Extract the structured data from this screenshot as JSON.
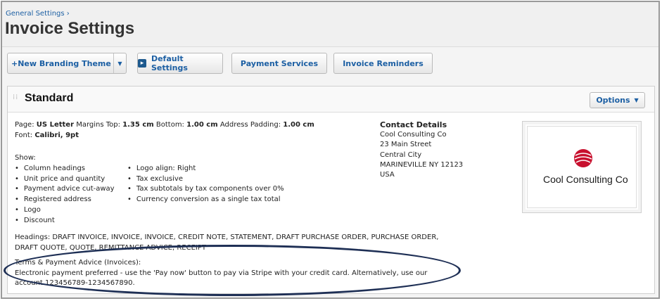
{
  "header": {
    "breadcrumb": "General Settings ›",
    "title": "Invoice Settings"
  },
  "toolbar": {
    "new_branding_theme": "New Branding Theme",
    "default_settings": "Default Settings",
    "payment_services": "Payment Services",
    "invoice_reminders": "Invoice Reminders"
  },
  "panel": {
    "title": "Standard",
    "options_label": "Options",
    "page_line": {
      "page_label": "Page:",
      "page_value": "US Letter",
      "margins_top_label": "Margins Top:",
      "margins_top_value": "1.35 cm",
      "bottom_label": "Bottom:",
      "bottom_value": "1.00 cm",
      "padding_label": "Address Padding:",
      "padding_value": "1.00 cm"
    },
    "font_line": {
      "font_label": "Font:",
      "font_value": "Calibri, 9pt"
    },
    "show_label": "Show:",
    "show_items_col1": [
      "Column headings",
      "Unit price and quantity",
      "Payment advice cut-away",
      "Registered address",
      "Logo",
      "Discount"
    ],
    "show_items_col2": [
      "Logo align: Right",
      "Tax exclusive",
      "Tax subtotals by tax components over 0%",
      "Currency conversion as a single tax total"
    ],
    "headings_text": "Headings: DRAFT INVOICE, INVOICE, INVOICE, CREDIT NOTE, STATEMENT, DRAFT PURCHASE ORDER, PURCHASE ORDER, DRAFT QUOTE, QUOTE, REMITTANCE ADVICE, RECEIPT",
    "terms_label": "Terms & Payment Advice (Invoices):",
    "terms_text": "Electronic payment preferred - use the 'Pay now' button to pay via Stripe with your credit card. Alternatively, use our account 123456789-1234567890.",
    "contact": {
      "heading": "Contact Details",
      "lines": [
        "Cool Consulting Co",
        "23 Main Street",
        "Central City",
        "MARINEVILLE NY 12123",
        "USA"
      ]
    },
    "logo_text": "Cool Consulting Co"
  },
  "colors": {
    "link_blue": "#1c5fa3",
    "logo_red": "#c8102e",
    "annotation_navy": "#1e2f55"
  }
}
